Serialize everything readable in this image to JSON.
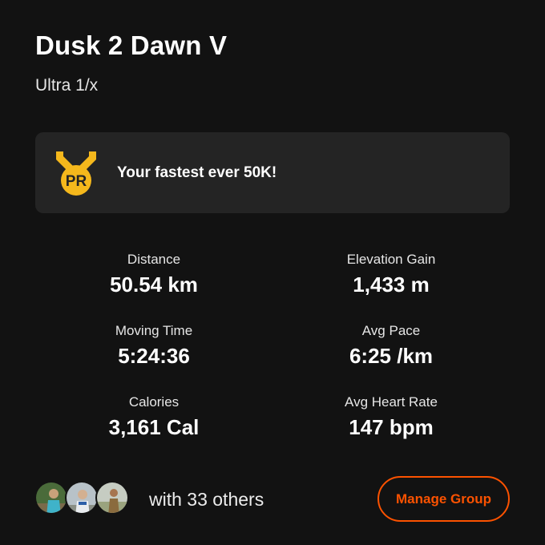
{
  "activity": {
    "title": "Dusk 2 Dawn V",
    "subtitle": "Ultra 1/x"
  },
  "achievement": {
    "badge_label": "PR",
    "badge_color": "#F5B81C",
    "text": "Your fastest ever 50K!"
  },
  "stats": [
    {
      "label": "Distance",
      "value": "50.54 km"
    },
    {
      "label": "Elevation Gain",
      "value": "1,433 m"
    },
    {
      "label": "Moving Time",
      "value": "5:24:36"
    },
    {
      "label": "Avg Pace",
      "value": "6:25 /km"
    },
    {
      "label": "Calories",
      "value": "3,161 Cal"
    },
    {
      "label": "Avg Heart Rate",
      "value": "147 bpm"
    }
  ],
  "group": {
    "others_text": "with 33 others",
    "manage_label": "Manage Group"
  },
  "colors": {
    "background": "#121212",
    "card": "#242424",
    "accent": "#FC5200",
    "pr_gold": "#F5B81C"
  }
}
